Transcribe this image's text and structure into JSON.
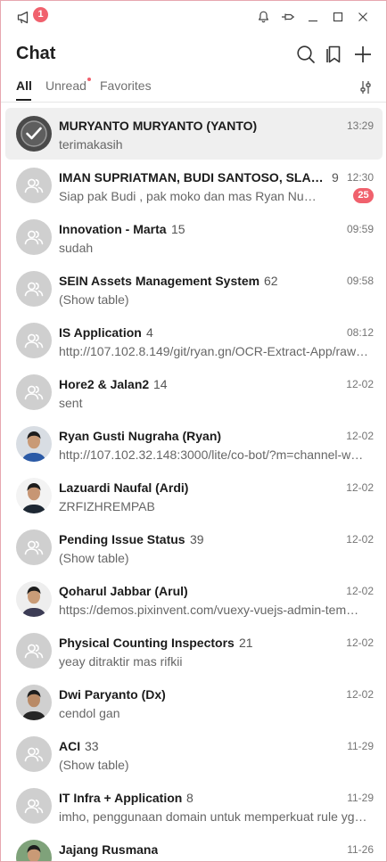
{
  "titlebar": {
    "notice_count": "1",
    "icons": [
      "megaphone-icon",
      "bell-icon",
      "pin-icon",
      "minimize-icon",
      "maximize-icon",
      "close-icon"
    ]
  },
  "header": {
    "title": "Chat",
    "icons": [
      "search-icon",
      "bookmark-icon",
      "plus-icon"
    ]
  },
  "tabs": [
    {
      "label": "All",
      "active": true
    },
    {
      "label": "Unread",
      "active": false,
      "dot": true
    },
    {
      "label": "Favorites",
      "active": false
    }
  ],
  "colors": {
    "accent_badge": "#f0616d",
    "selected_row": "#efefef",
    "group_avatar": "#cfcfcf",
    "window_border": "#e7a7b0"
  },
  "chats": [
    {
      "name": "MURYANTO MURYANTO (YANTO)",
      "count": "",
      "time": "13:29",
      "message": "terimakasih",
      "avatar": "checkmark-avatar",
      "selected": true,
      "unread": ""
    },
    {
      "name": "IMAN SUPRIATMAN, BUDI SANTOSO, SLAMET …",
      "count": "9",
      "time": "12:30",
      "message": "Siap pak Budi , pak moko dan mas Ryan Nuhun ya …",
      "avatar": "group",
      "selected": false,
      "unread": "25"
    },
    {
      "name": "Innovation - Marta",
      "count": "15",
      "time": "09:59",
      "message": "sudah",
      "avatar": "group",
      "selected": false,
      "unread": ""
    },
    {
      "name": "SEIN Assets Management System",
      "count": "62",
      "time": "09:58",
      "message": "(Show table)",
      "avatar": "group",
      "selected": false,
      "unread": ""
    },
    {
      "name": "IS Application",
      "count": "4",
      "time": "08:12",
      "message": "http://107.102.8.149/git/ryan.gn/OCR-Extract-App/raw…",
      "avatar": "group",
      "selected": false,
      "unread": ""
    },
    {
      "name": "Hore2 & Jalan2",
      "count": "14",
      "time": "12-02",
      "message": "sent",
      "avatar": "group",
      "selected": false,
      "unread": ""
    },
    {
      "name": "Ryan Gusti Nugraha (Ryan)",
      "count": "",
      "time": "12-02",
      "message": "http://107.102.32.148:3000/lite/co-bot/?m=channel-w…",
      "avatar": "person-blue",
      "selected": false,
      "unread": ""
    },
    {
      "name": "Lazuardi Naufal (Ardi)",
      "count": "",
      "time": "12-02",
      "message": "ZRFIZHREMPAB",
      "avatar": "person-suit",
      "selected": false,
      "unread": ""
    },
    {
      "name": "Pending Issue Status",
      "count": "39",
      "time": "12-02",
      "message": "(Show table)",
      "avatar": "group",
      "selected": false,
      "unread": ""
    },
    {
      "name": "Qoharul Jabbar (Arul)",
      "count": "",
      "time": "12-02",
      "message": "https://demos.pixinvent.com/vuexy-vuejs-admin-tem…",
      "avatar": "person-batik",
      "selected": false,
      "unread": ""
    },
    {
      "name": "Physical Counting Inspectors",
      "count": "21",
      "time": "12-02",
      "message": "yeay ditraktir mas rifkii",
      "avatar": "group",
      "selected": false,
      "unread": ""
    },
    {
      "name": "Dwi Paryanto (Dx)",
      "count": "",
      "time": "12-02",
      "message": "cendol gan",
      "avatar": "person-dark",
      "selected": false,
      "unread": ""
    },
    {
      "name": "ACI",
      "count": "33",
      "time": "11-29",
      "message": "(Show table)",
      "avatar": "group",
      "selected": false,
      "unread": ""
    },
    {
      "name": "IT Infra + Application",
      "count": "8",
      "time": "11-29",
      "message": "imho, penggunaan domain untuk memperkuat rule yg …",
      "avatar": "group",
      "selected": false,
      "unread": ""
    },
    {
      "name": "Jajang Rusmana",
      "count": "",
      "time": "11-26",
      "message": "",
      "avatar": "person-green",
      "selected": false,
      "unread": ""
    }
  ]
}
